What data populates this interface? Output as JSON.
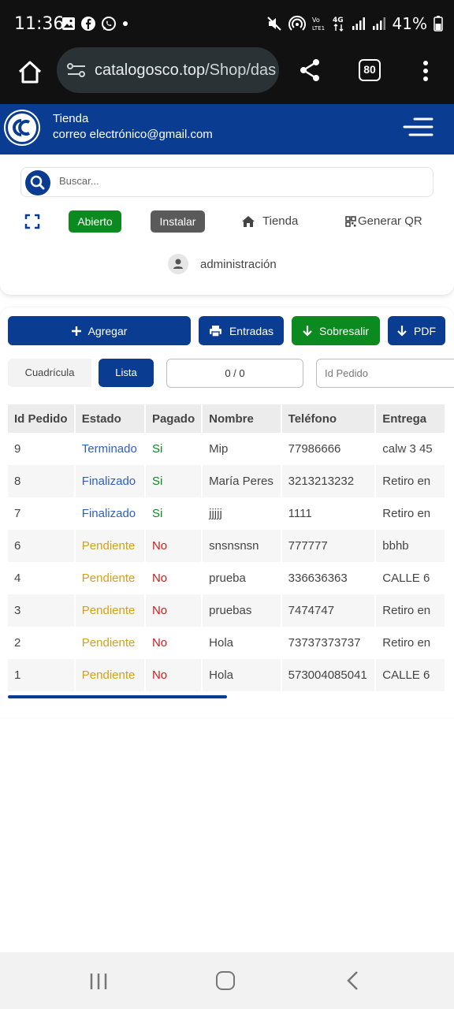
{
  "status_bar": {
    "time": "11:36",
    "battery": "41%"
  },
  "browser": {
    "url_host": "catalogosco.top",
    "url_path": "/Shop/das",
    "tab_count": "80"
  },
  "header": {
    "store_name": "Tienda",
    "store_email": "correo electrónico@gmail.com"
  },
  "toolbar": {
    "search_placeholder": "Buscar...",
    "open_label": "Abierto",
    "install_label": "Instalar",
    "store_link": "Tienda",
    "qr_link": "Generar QR",
    "admin_link": "administración"
  },
  "actions": {
    "add_label": "Agregar",
    "entries_label": "Entradas",
    "excel_label": "Sobresalir",
    "pdf_label": "PDF"
  },
  "view": {
    "grid_label": "Cuadrícula",
    "list_label": "Lista",
    "counter": "0 / 0",
    "order_filter_placeholder": "Id Pedido"
  },
  "table": {
    "columns": [
      "Id Pedido",
      "Estado",
      "Pagado",
      "Nombre",
      "Teléfono",
      "Entrega"
    ],
    "rows": [
      {
        "id": "9",
        "estado": "Terminado",
        "pagado": "Si",
        "nombre": "Mip",
        "telefono": "77986666",
        "entrega": "calw 3 45"
      },
      {
        "id": "8",
        "estado": "Finalizado",
        "pagado": "Si",
        "nombre": "María Peres",
        "telefono": "3213213232",
        "entrega": "Retiro en"
      },
      {
        "id": "7",
        "estado": "Finalizado",
        "pagado": "Si",
        "nombre": "jjjjj",
        "telefono": "1111",
        "entrega": "Retiro en"
      },
      {
        "id": "6",
        "estado": "Pendiente",
        "pagado": "No",
        "nombre": "snsnsnsn",
        "telefono": "777777",
        "entrega": "bbhb"
      },
      {
        "id": "4",
        "estado": "Pendiente",
        "pagado": "No",
        "nombre": "prueba",
        "telefono": "336636363",
        "entrega": "CALLE 6"
      },
      {
        "id": "3",
        "estado": "Pendiente",
        "pagado": "No",
        "nombre": "pruebas",
        "telefono": "7474747",
        "entrega": "Retiro en"
      },
      {
        "id": "2",
        "estado": "Pendiente",
        "pagado": "No",
        "nombre": "Hola",
        "telefono": "73737373737",
        "entrega": "Retiro en"
      },
      {
        "id": "1",
        "estado": "Pendiente",
        "pagado": "No",
        "nombre": "Hola",
        "telefono": "573004085041",
        "entrega": "CALLE 6"
      }
    ]
  },
  "colors": {
    "primary": "#0a3d91",
    "success": "#0a8a1f",
    "status_done": "#2e5fbf",
    "status_pending": "#d4a017",
    "paid_yes": "#0a8a1f",
    "paid_no": "#d01c1c"
  }
}
